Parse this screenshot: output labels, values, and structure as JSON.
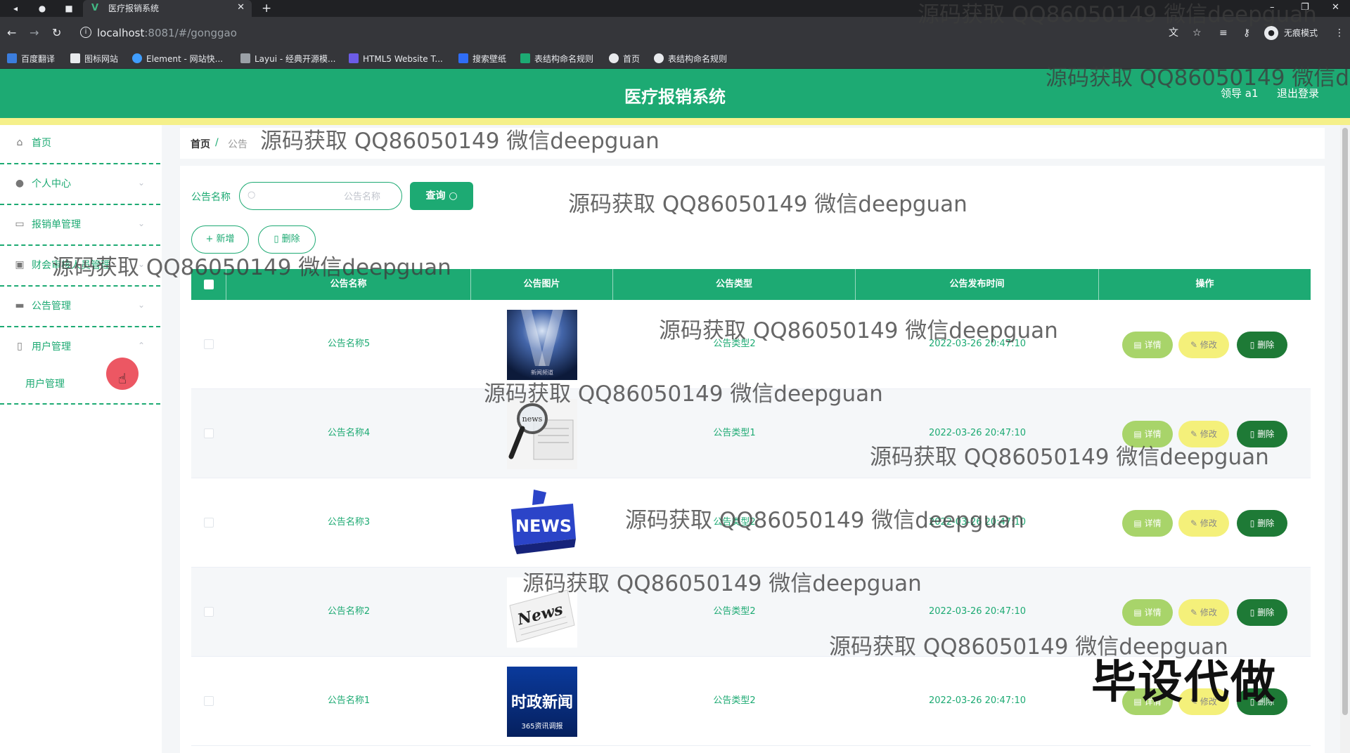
{
  "browser": {
    "tab_title": "医疗报销系统",
    "url_host": "localhost",
    "url_rest": ":8081/#/gonggao",
    "incognito_label": "无痕模式",
    "bookmarks": [
      "百度翻译",
      "图标网站",
      "Element - 网站快...",
      "Layui - 经典开源模...",
      "HTML5 Website T...",
      "搜索壁纸",
      "表结构命名规则",
      "首页",
      "表结构命名规则"
    ]
  },
  "app": {
    "title": "医疗报销系统",
    "user": "领导 a1",
    "logout": "退出登录"
  },
  "sidebar": {
    "items": [
      {
        "label": "首页"
      },
      {
        "label": "个人中心"
      },
      {
        "label": "报销单管理"
      },
      {
        "label": "财会审核人员管理"
      },
      {
        "label": "公告管理"
      },
      {
        "label": "用户管理"
      }
    ],
    "sub_item": "用户管理"
  },
  "breadcrumb": {
    "home": "首页",
    "sep": "/",
    "current": "公告"
  },
  "search": {
    "label": "公告名称",
    "placeholder": "公告名称",
    "value": "",
    "button": "查询"
  },
  "toolbar": {
    "add": "新增",
    "delete": "删除"
  },
  "table": {
    "headers": [
      "公告名称",
      "公告图片",
      "公告类型",
      "公告发布时间",
      "操作"
    ],
    "rows": [
      {
        "name": "公告名称5",
        "type": "公告类型2",
        "time": "2022-03-26 20:47:10",
        "image": "spotlight"
      },
      {
        "name": "公告名称4",
        "type": "公告类型1",
        "time": "2022-03-26 20:47:10",
        "image": "magnifier-news"
      },
      {
        "name": "公告名称3",
        "type": "公告类型2",
        "time": "2022-03-26 20:47:10",
        "image": "news-3d"
      },
      {
        "name": "公告名称2",
        "type": "公告类型2",
        "time": "2022-03-26 20:47:10",
        "image": "news-paper"
      },
      {
        "name": "公告名称1",
        "type": "公告类型2",
        "time": "2022-03-26 20:47:10",
        "image": "shizheng-news"
      }
    ],
    "actions": {
      "detail": "详情",
      "edit": "修改",
      "delete": "删除"
    }
  },
  "image_text": {
    "spotlight": "新闻频道",
    "news_3d": "NEWS",
    "news_paper": "News",
    "magnifier": "news",
    "shizheng_title": "时政新闻",
    "shizheng_sub": "365资讯调报"
  },
  "watermark": {
    "text": "源码获取 QQ86050149 微信deepguan",
    "text_cut": "源码获取 QQ86050149 微信dee",
    "stamp": "毕设代做"
  },
  "colors": {
    "primary": "#1daa73",
    "header_stripe": "#f5f08a",
    "detail": "#a8d46a",
    "edit": "#f4f07a",
    "delete": "#1e7a36"
  }
}
